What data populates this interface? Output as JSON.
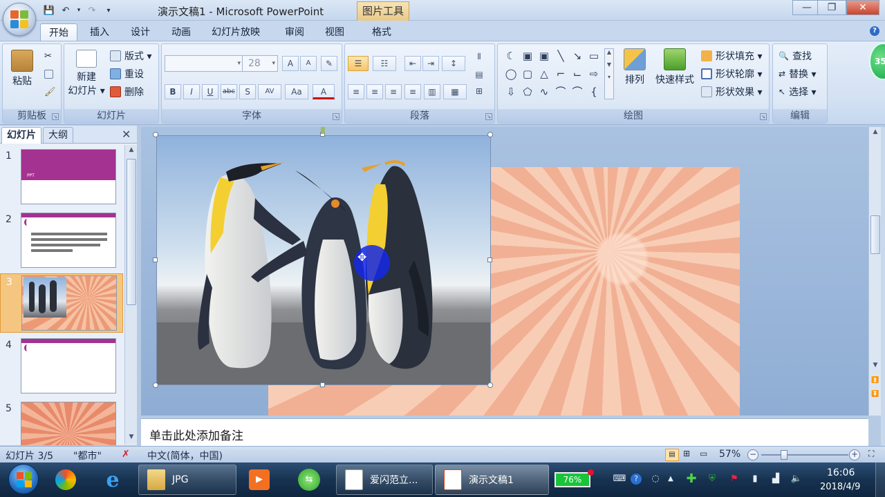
{
  "window": {
    "title": "演示文稿1 - Microsoft PowerPoint",
    "context_tab": "图片工具",
    "minimize": "—",
    "restore": "❐",
    "close": "✕"
  },
  "qat": {
    "save": "💾",
    "undo": "↶",
    "redo": "↷",
    "customize": "▾"
  },
  "ribbon_tabs": [
    "开始",
    "插入",
    "设计",
    "动画",
    "幻灯片放映",
    "审阅",
    "视图",
    "格式"
  ],
  "help": "?",
  "clipboard": {
    "label": "剪贴板",
    "paste": "粘贴"
  },
  "slides_group": {
    "label": "幻灯片",
    "new_slide_line1": "新建",
    "new_slide_line2": "幻灯片 ▾",
    "layout": "版式 ▾",
    "reset": "重设",
    "delete": "删除"
  },
  "font_group": {
    "label": "字体",
    "font_name": "",
    "font_size": "28",
    "bold": "B",
    "italic": "I",
    "underline": "U",
    "strike": "abc",
    "shadow": "S",
    "spacing": "AV",
    "case": "Aa",
    "color": "A",
    "grow": "A",
    "shrink": "A"
  },
  "paragraph_group": {
    "label": "段落"
  },
  "drawing_group": {
    "label": "绘图",
    "arrange": "排列",
    "quick_styles": "快速样式",
    "shape_fill": "形状填充 ▾",
    "shape_outline": "形状轮廓 ▾",
    "shape_effects": "形状效果 ▾"
  },
  "editing_group": {
    "label": "编辑",
    "find": "查找",
    "replace": "替换 ▾",
    "select": "选择 ▾"
  },
  "badge": "35",
  "pane": {
    "tab_slides": "幻灯片",
    "tab_outline": "大纲",
    "close": "✕"
  },
  "thumbnails": [
    {
      "num": "1",
      "caption": "PPT"
    },
    {
      "num": "2",
      "caption": ""
    },
    {
      "num": "3",
      "caption": ""
    },
    {
      "num": "4",
      "caption": ""
    },
    {
      "num": "5",
      "caption": ""
    }
  ],
  "notes_placeholder": "单击此处添加备注",
  "status": {
    "slide_info": "幻灯片 3/5",
    "theme": "\"都市\"",
    "language": "中文(简体，中国)",
    "zoom": "57%"
  },
  "taskbar": {
    "tasks": [
      "JPG",
      "爱闪范立...",
      "演示文稿1"
    ],
    "battery": "76%",
    "time": "16:06",
    "date": "2018/4/9"
  },
  "colors": {
    "accent_purple": "#a33291",
    "selected_thumb": "#f4c680",
    "ribbon_blue": "#d3e1f3"
  }
}
